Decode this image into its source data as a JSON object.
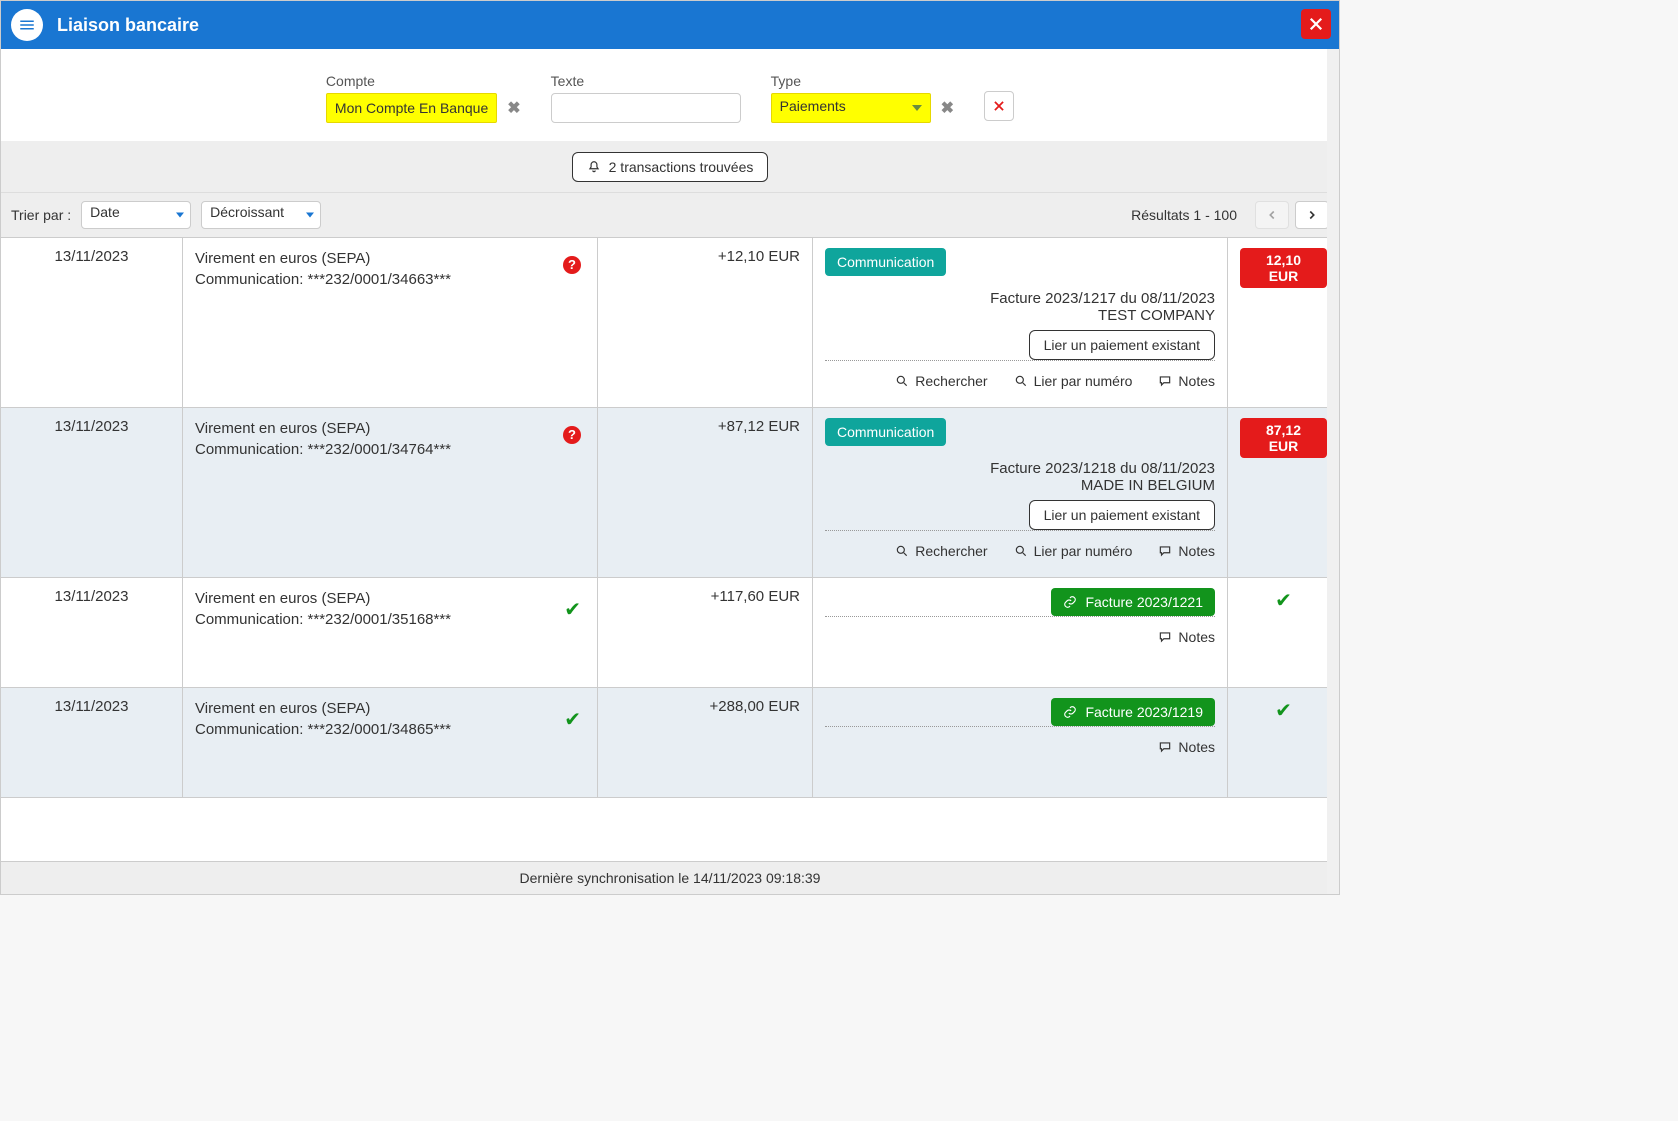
{
  "header": {
    "title": "Liaison bancaire"
  },
  "filters": {
    "compte_label": "Compte",
    "compte_value": "Mon Compte En Banque",
    "texte_label": "Texte",
    "texte_value": "",
    "type_label": "Type",
    "type_value": "Paiements"
  },
  "notice": {
    "text": "2 transactions trouvées"
  },
  "sortbar": {
    "label": "Trier par :",
    "sort_field": "Date",
    "sort_order": "Décroissant",
    "results": "Résultats 1 - 100"
  },
  "actions": {
    "communication": "Communication",
    "link_existing": "Lier un paiement existant",
    "search": "Rechercher",
    "link_by_number": "Lier par numéro",
    "notes": "Notes"
  },
  "transactions": [
    {
      "date": "13/11/2023",
      "desc1": "Virement en euros (SEPA)",
      "desc2": "Communication: ***232/0001/34663***",
      "amount": "+12,10 EUR",
      "matched": false,
      "badge_amount": "12,10 EUR",
      "invoice_line": "Facture 2023/1217 du 08/11/2023",
      "company": "TEST COMPANY"
    },
    {
      "date": "13/11/2023",
      "desc1": "Virement en euros (SEPA)",
      "desc2": "Communication: ***232/0001/34764***",
      "amount": "+87,12 EUR",
      "matched": false,
      "badge_amount": "87,12 EUR",
      "invoice_line": "Facture 2023/1218 du 08/11/2023",
      "company": "MADE IN BELGIUM"
    },
    {
      "date": "13/11/2023",
      "desc1": "Virement en euros (SEPA)",
      "desc2": "Communication: ***232/0001/35168***",
      "amount": "+117,60 EUR",
      "matched": true,
      "facture_label": "Facture 2023/1221"
    },
    {
      "date": "13/11/2023",
      "desc1": "Virement en euros (SEPA)",
      "desc2": "Communication: ***232/0001/34865***",
      "amount": "+288,00 EUR",
      "matched": true,
      "facture_label": "Facture 2023/1219"
    }
  ],
  "footer": {
    "text": "Dernière synchronisation le 14/11/2023 09:18:39"
  }
}
